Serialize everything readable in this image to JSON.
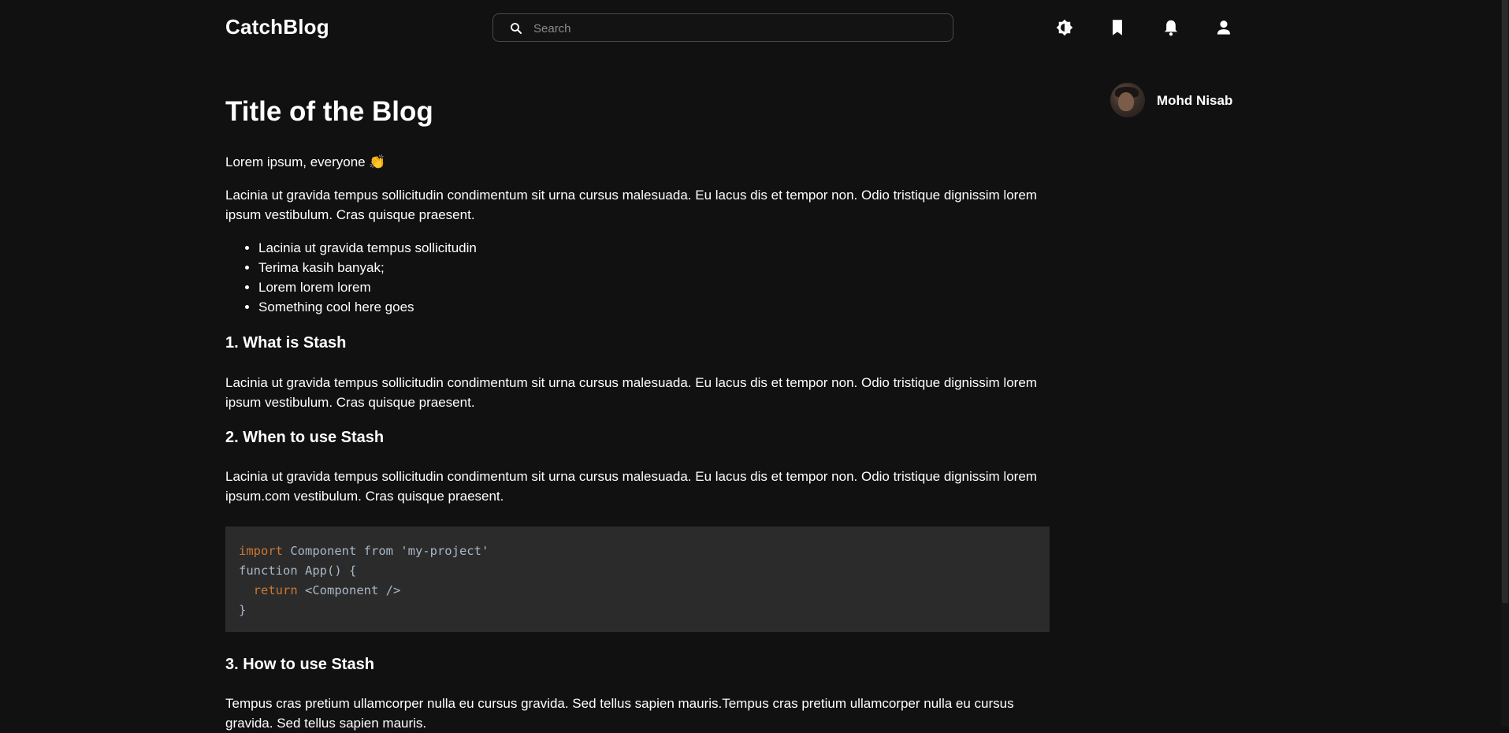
{
  "header": {
    "brand": "CatchBlog",
    "search": {
      "placeholder": "Search"
    },
    "icons": [
      "theme-toggle-icon",
      "bookmark-icon",
      "notifications-bell-icon",
      "user-profile-icon"
    ]
  },
  "article": {
    "title": "Title of the Blog",
    "greeting": "Lorem ipsum, everyone 👏",
    "paragraph1": "Lacinia ut gravida tempus sollicitudin condimentum sit urna cursus malesuada. Eu lacus dis et tempor non. Odio tristique dignissim lorem ipsum vestibulum. Cras quisque praesent.",
    "list": [
      "Lacinia ut gravida tempus sollicitudin",
      "Terima kasih banyak;",
      "Lorem lorem lorem",
      "Something cool here goes"
    ],
    "section1": {
      "heading": "1. What is Stash",
      "text": "Lacinia ut gravida tempus sollicitudin condimentum sit urna cursus malesuada. Eu lacus dis et tempor non. Odio tristique dignissim lorem ipsum vestibulum. Cras quisque praesent."
    },
    "section2": {
      "heading": "2. When to use Stash",
      "text": "Lacinia ut gravida tempus sollicitudin condimentum sit urna cursus malesuada. Eu lacus dis et tempor non. Odio tristique dignissim lorem ipsum.com vestibulum. Cras quisque praesent."
    },
    "code": {
      "line1_kw": "import",
      "line1_rest": " Component from 'my-project'",
      "line2": "function App() {",
      "line3_indent": "  ",
      "line3_kw": "return",
      "line3_rest": " <Component />",
      "line4": "}"
    },
    "section3": {
      "heading": "3. How to use Stash",
      "text": "Tempus cras pretium ullamcorper nulla eu cursus gravida. Sed tellus sapien mauris.Tempus cras pretium ullamcorper nulla eu cursus gravida. Sed tellus sapien mauris."
    }
  },
  "author": {
    "name": "Mohd Nisab"
  },
  "colors": {
    "background": "#111111",
    "text": "#ffffff",
    "code_background": "#2b2b2b",
    "code_keyword": "#cc7832",
    "code_text": "#a9b7c6"
  }
}
